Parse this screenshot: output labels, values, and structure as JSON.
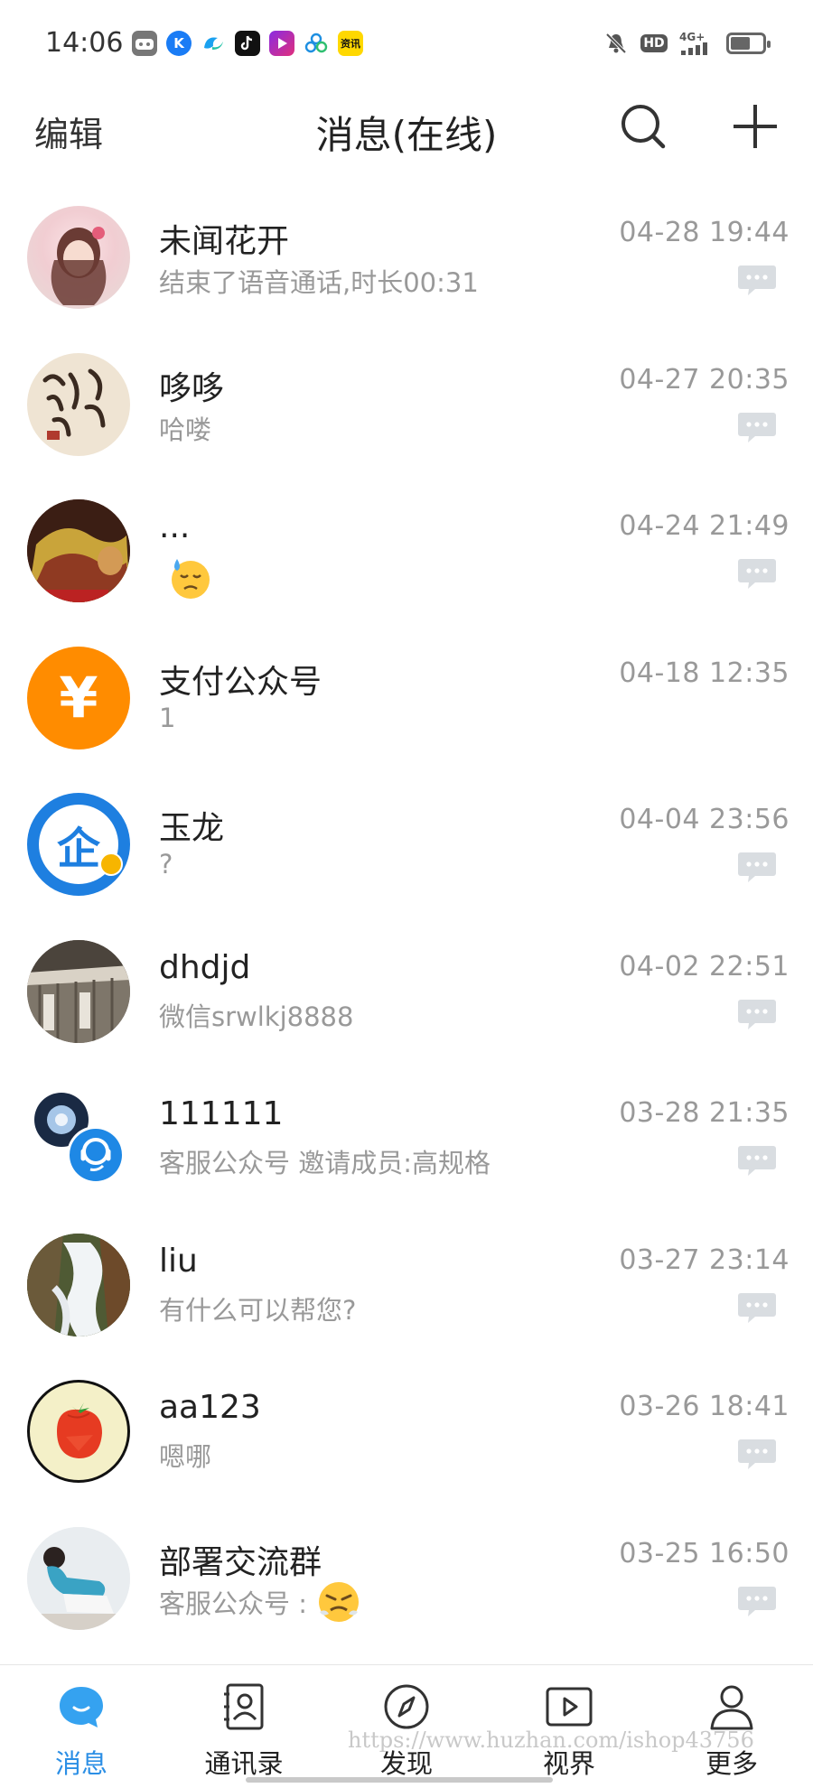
{
  "status_bar": {
    "time": "14:06",
    "app_icons": [
      "game-app-icon",
      "kugou-icon",
      "browser-icon",
      "tiktok-icon",
      "video-app-icon",
      "cloud-app-icon",
      "news-app-icon"
    ],
    "kugou_glyph": "K",
    "news_glyph": "资讯",
    "hd_label": "HD",
    "network_label": "4G+",
    "battery_level": 0.55
  },
  "header": {
    "edit_label": "编辑",
    "title": "消息(在线)"
  },
  "conversations": [
    {
      "name": "未闻花开",
      "preview": "结束了语音通话,时长00:31",
      "time": "04-28  19:44",
      "has_badge": true
    },
    {
      "name": "哆哆",
      "preview": "哈喽",
      "time": "04-27  20:35",
      "has_badge": true
    },
    {
      "name": "...",
      "preview": "",
      "preview_emoji": "sad-sweat-emoji",
      "time": "04-24  21:49",
      "has_badge": true
    },
    {
      "name": "支付公众号",
      "preview": "1",
      "time": "04-18  12:35",
      "has_badge": false,
      "avatar_glyph": "¥"
    },
    {
      "name": "玉龙",
      "preview": "?",
      "time": "04-04  23:56",
      "has_badge": true,
      "avatar_glyph": "企"
    },
    {
      "name": "dhdjd",
      "preview": "微信srwlkj8888",
      "time": "04-02  22:51",
      "has_badge": true
    },
    {
      "name": "111111",
      "preview": "客服公众号  邀请成员:高规格",
      "time": "03-28  21:35",
      "has_badge": true
    },
    {
      "name": "liu",
      "preview": "有什么可以帮您?",
      "time": "03-27  23:14",
      "has_badge": true
    },
    {
      "name": "aa123",
      "preview": "嗯哪",
      "time": "03-26  18:41",
      "has_badge": true
    },
    {
      "name": "部署交流群",
      "preview": "客服公众号 :",
      "preview_emoji": "angry-steam-emoji",
      "time": "03-25  16:50",
      "has_badge": true
    }
  ],
  "bottom_nav": [
    {
      "label": "消息",
      "active": true
    },
    {
      "label": "通讯录",
      "active": false
    },
    {
      "label": "发现",
      "active": false
    },
    {
      "label": "视界",
      "active": false
    },
    {
      "label": "更多",
      "active": false
    }
  ],
  "watermark": "https://www.huzhan.com/ishop43756",
  "colors": {
    "accent": "#2c8fe5",
    "pay_orange": "#ff8c00",
    "text_gray": "#999999"
  }
}
